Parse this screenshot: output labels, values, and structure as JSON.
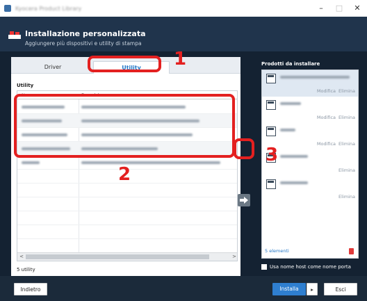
{
  "window": {
    "title": "Kyocera Product Library",
    "controls": [
      "–",
      "□",
      "✕"
    ]
  },
  "header": {
    "title": "Installazione personalizzata",
    "subtitle": "Aggiungere più dispositivi e utility di stampa"
  },
  "tabs": [
    {
      "label": "Driver",
      "active": false
    },
    {
      "label": "Utility",
      "active": true
    }
  ],
  "utility_section": {
    "label": "Utility",
    "columns": [
      "Nome",
      "Descrizione"
    ],
    "row_count": 5,
    "count_label": "5 utility"
  },
  "products": {
    "title": "Prodotti da installare",
    "items": [
      {
        "modify": "Modifica",
        "remove": "Elimina"
      },
      {
        "modify": "Modifica",
        "remove": "Elimina"
      },
      {
        "modify": "Modifica",
        "remove": "Elimina"
      },
      {
        "modify": "",
        "remove": "Elimina"
      },
      {
        "modify": "",
        "remove": "Elimina"
      }
    ],
    "footer": "5 elementi",
    "hostname_checkbox": "Usa nome host come nome porta"
  },
  "callouts": [
    "1",
    "2",
    "3"
  ],
  "buttons": {
    "back": "Indietro",
    "install": "Installa",
    "split_arrow": "▸",
    "exit": "Esci"
  },
  "colors": {
    "accent": "#2f7fd0",
    "callout": "#e32020",
    "header_bg": "#20344c",
    "body_bg": "#142232"
  },
  "icons": {
    "add": "arrow-right-icon",
    "trash": "trash-icon",
    "printer": "printer-icon"
  }
}
